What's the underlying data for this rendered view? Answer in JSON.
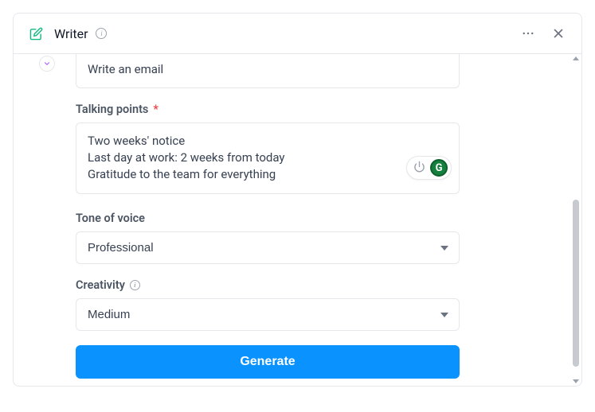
{
  "header": {
    "title": "Writer"
  },
  "form": {
    "email_label": "Write an email",
    "talking_points": {
      "label": "Talking points",
      "required_marker": "*",
      "value": "Two weeks' notice\nLast day at work: 2 weeks from today\nGratitude to the team for everything"
    },
    "tone": {
      "label": "Tone of voice",
      "value": "Professional"
    },
    "creativity": {
      "label": "Creativity",
      "value": "Medium"
    },
    "generate_label": "Generate"
  },
  "grammarly": {
    "badge": "G"
  }
}
